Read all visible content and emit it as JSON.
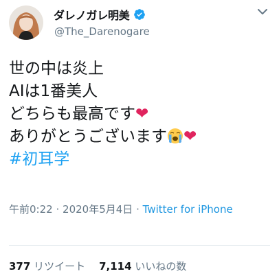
{
  "tweet": {
    "display_name": "ダレノガレ明美",
    "handle": "@The_Darenogare",
    "lines": [
      "世の中は炎上",
      "AIは1番美人",
      "どちらも最高です",
      "ありがとうございます"
    ],
    "hashtag": "#初耳学",
    "time": "午前0:22",
    "date": "2020年5月4日",
    "separator": "·",
    "source": "Twitter for iPhone"
  },
  "stats": {
    "retweet_count": "377",
    "retweet_label": "リツイート",
    "like_count": "7,114",
    "like_label": "いいねの数"
  },
  "icons": {
    "verified": "verified-badge-icon",
    "caret": "chevron-down-icon",
    "heart": "red-heart-emoji",
    "crying": "loudly-crying-face-emoji"
  },
  "colors": {
    "link": "#1da1f2",
    "source_link": "#1b95e0",
    "muted": "#657786",
    "text": "#14171a",
    "heart": "#e0245e"
  }
}
